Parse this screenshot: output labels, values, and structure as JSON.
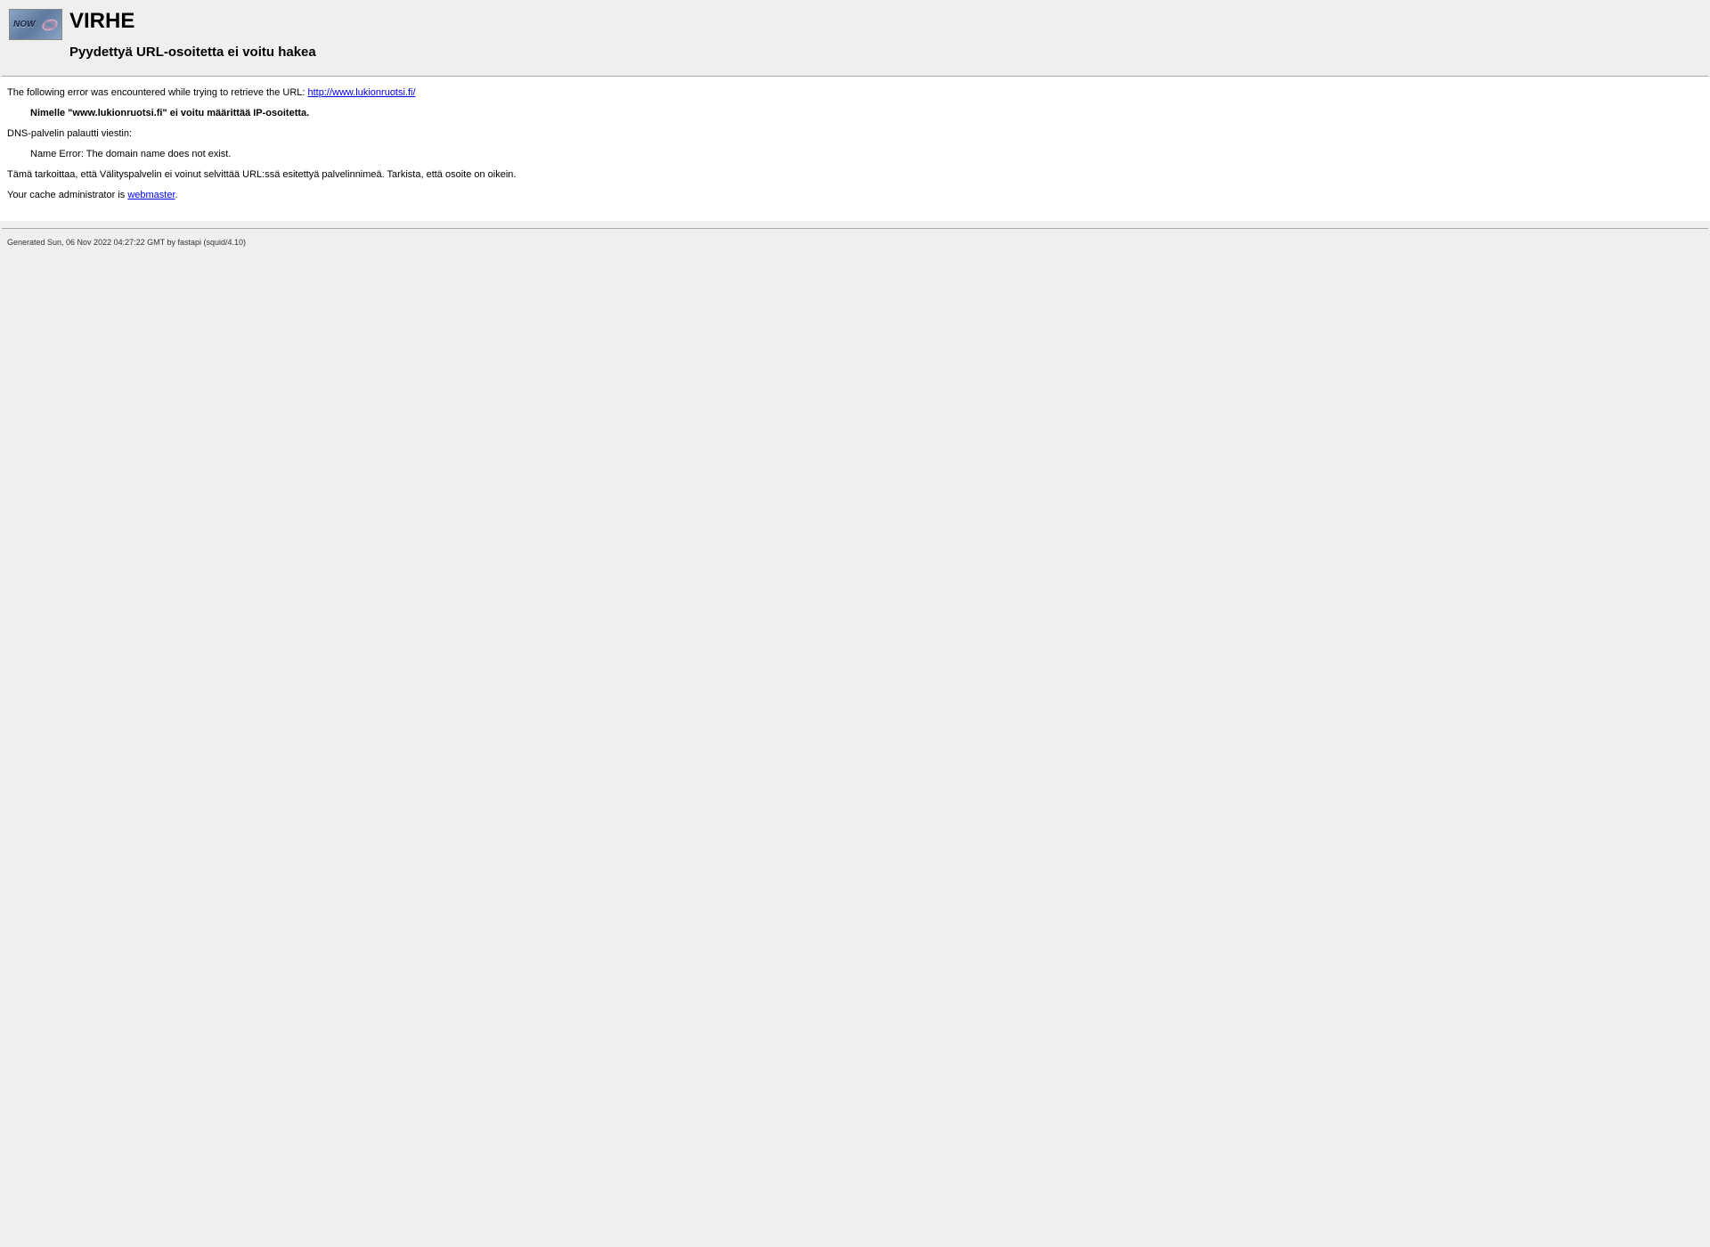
{
  "header": {
    "icon_text": "NOW",
    "title": "VIRHE",
    "subtitle": "Pyydettyä URL-osoitetta ei voitu hakea"
  },
  "content": {
    "error_intro": "The following error was encountered while trying to retrieve the URL: ",
    "error_url": "http://www.lukionruotsi.fi/",
    "error_message": "Nimelle \"www.lukionruotsi.fi\" ei voitu määrittää IP-osoitetta.",
    "dns_intro": "DNS-palvelin palautti viestin:",
    "dns_message": "Name Error: The domain name does not exist.",
    "explanation": "Tämä tarkoittaa, että Välityspalvelin ei voinut selvittää URL:ssä esitettyä palvelinnimeä. Tarkista, että osoite on oikein.",
    "admin_intro": "Your cache administrator is ",
    "admin_link": "webmaster",
    "admin_suffix": "."
  },
  "footer": {
    "generated": "Generated Sun, 06 Nov 2022 04:27:22 GMT by fastapi (squid/4.10)"
  }
}
